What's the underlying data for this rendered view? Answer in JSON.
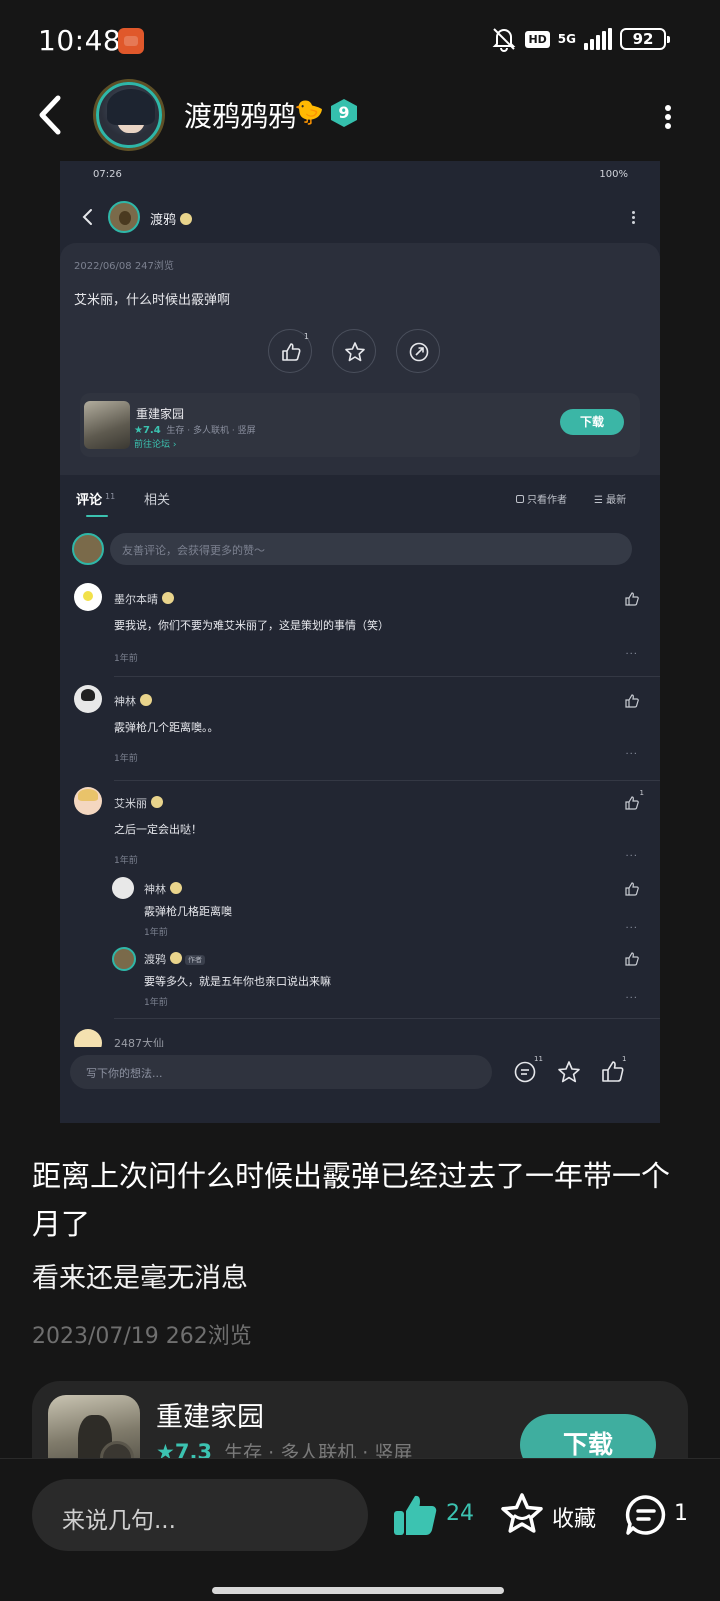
{
  "status_bar": {
    "time": "10:48",
    "hd": "HD",
    "network": "5G",
    "battery": "92"
  },
  "header": {
    "username": "渡鸦鸦鸦",
    "emoji": "🐤",
    "level": "9"
  },
  "embedded": {
    "status_time": "07:26",
    "status_battery": "100%",
    "author": "渡鸦",
    "meta": "2022/06/08  247浏览",
    "text": "艾米丽，什么时候出霰弹啊",
    "like_count": "1",
    "game": {
      "name": "重建家园",
      "rating": "★7.4",
      "tags": "生存 · 多人联机 · 竖屏",
      "link": "前往论坛 ›",
      "download": "下载"
    },
    "tabs": {
      "comments": "评论",
      "comments_count": "11",
      "related": "相关",
      "only_author": "只看作者",
      "sort": "最新"
    },
    "comment_placeholder": "友善评论，会获得更多的赞～",
    "comments": [
      {
        "name": "墨尔本晴",
        "text": "要我说，你们不要为难艾米丽了，这是策划的事情（笑）",
        "time": "1年前"
      },
      {
        "name": "神林",
        "text": "霰弹枪几个距离噢。。",
        "time": "1年前"
      },
      {
        "name": "艾米丽",
        "text": "之后一定会出哒！",
        "time": "1年前",
        "likes": "1"
      }
    ],
    "replies": [
      {
        "name": "神林",
        "text": "霰弹枪几格距离噢",
        "time": "1年前"
      },
      {
        "name": "渡鸦",
        "tag": "作者",
        "text": "要等多久，就是五年你也亲口说出来嘛",
        "time": "1年前"
      }
    ],
    "next_comment_name": "2487大仙",
    "write_placeholder": "写下你的想法...",
    "bottom_comment_count": "11",
    "bottom_like_count": "1"
  },
  "post": {
    "title": "距离上次问什么时候出霰弹已经过去了一年带一个月了",
    "subtitle": "看来还是毫无消息",
    "meta": "2023/07/19  262浏览"
  },
  "game_card": {
    "name": "重建家园",
    "rating": "★7.3",
    "tags": "生存 · 多人联机 · 竖屏",
    "download": "下载"
  },
  "bottom_bar": {
    "placeholder": "来说几句...",
    "like_count": "24",
    "favorite_label": "收藏",
    "comment_count": "1"
  },
  "colors": {
    "accent": "#3cc3b1",
    "background": "#161616",
    "embedded_bg": "#222632"
  }
}
